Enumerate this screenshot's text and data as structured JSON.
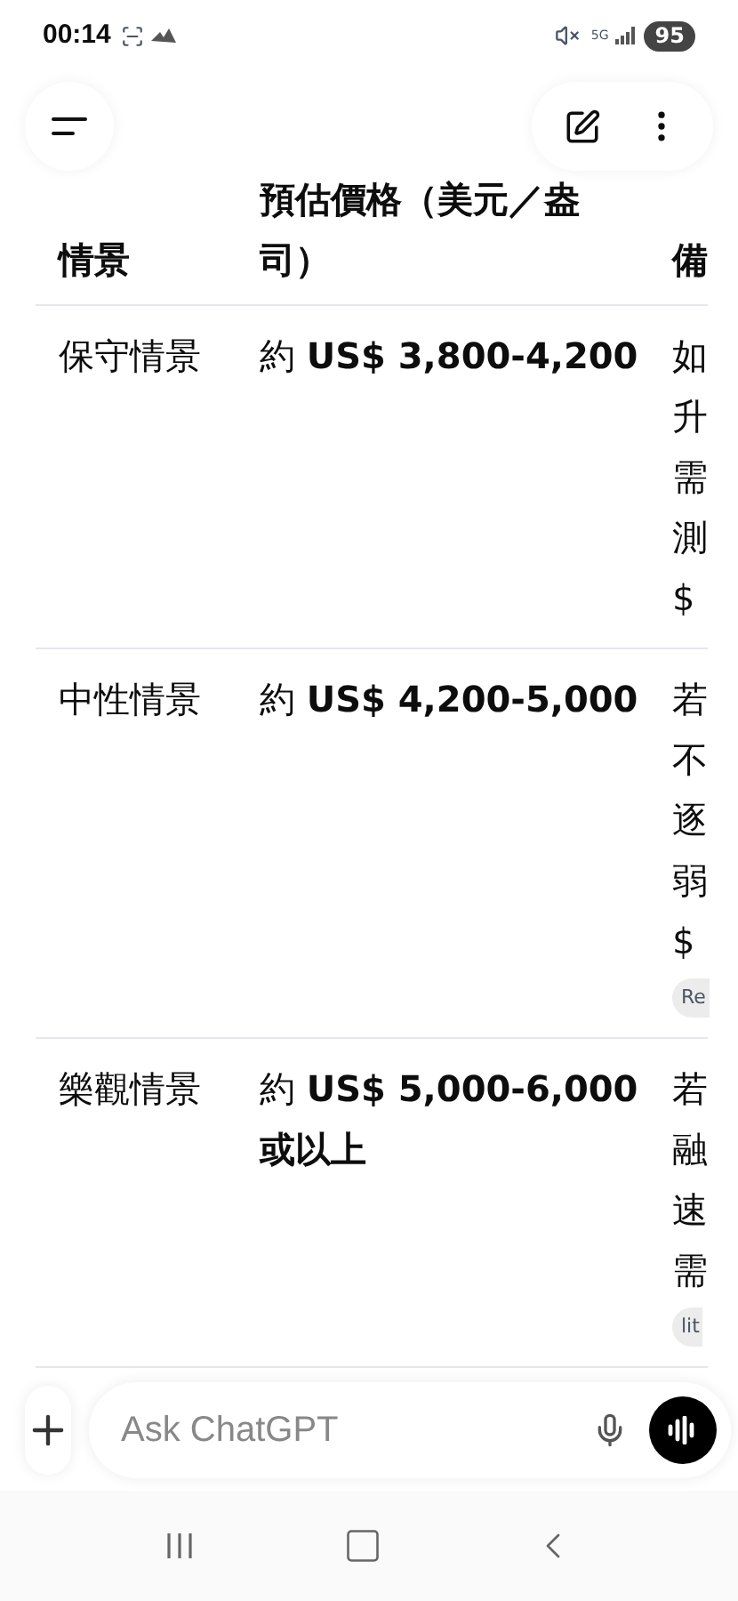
{
  "status_bar": {
    "time": "00:14",
    "network": "5G",
    "battery": "95"
  },
  "table": {
    "columns": [
      "情景",
      "預估價格（美元／盎司）",
      "備"
    ],
    "rows": [
      {
        "scenario": "保守情景",
        "price": "約 **US$ 3,800-4,200**",
        "notes": [
          "如",
          "升",
          "需",
          "測",
          "$"
        ]
      },
      {
        "scenario": "中性情景",
        "price": "約 **US$ 4,200-5,000**",
        "notes": [
          "若",
          "不",
          "逐",
          "弱",
          "$"
        ],
        "source": "Re"
      },
      {
        "scenario": "樂觀情景",
        "price": "約 **US$ 5,000-6,000 或以上**",
        "notes": [
          "若",
          "融",
          "速",
          "需"
        ],
        "source": "lit"
      }
    ]
  },
  "composer": {
    "placeholder": "Ask ChatGPT"
  }
}
